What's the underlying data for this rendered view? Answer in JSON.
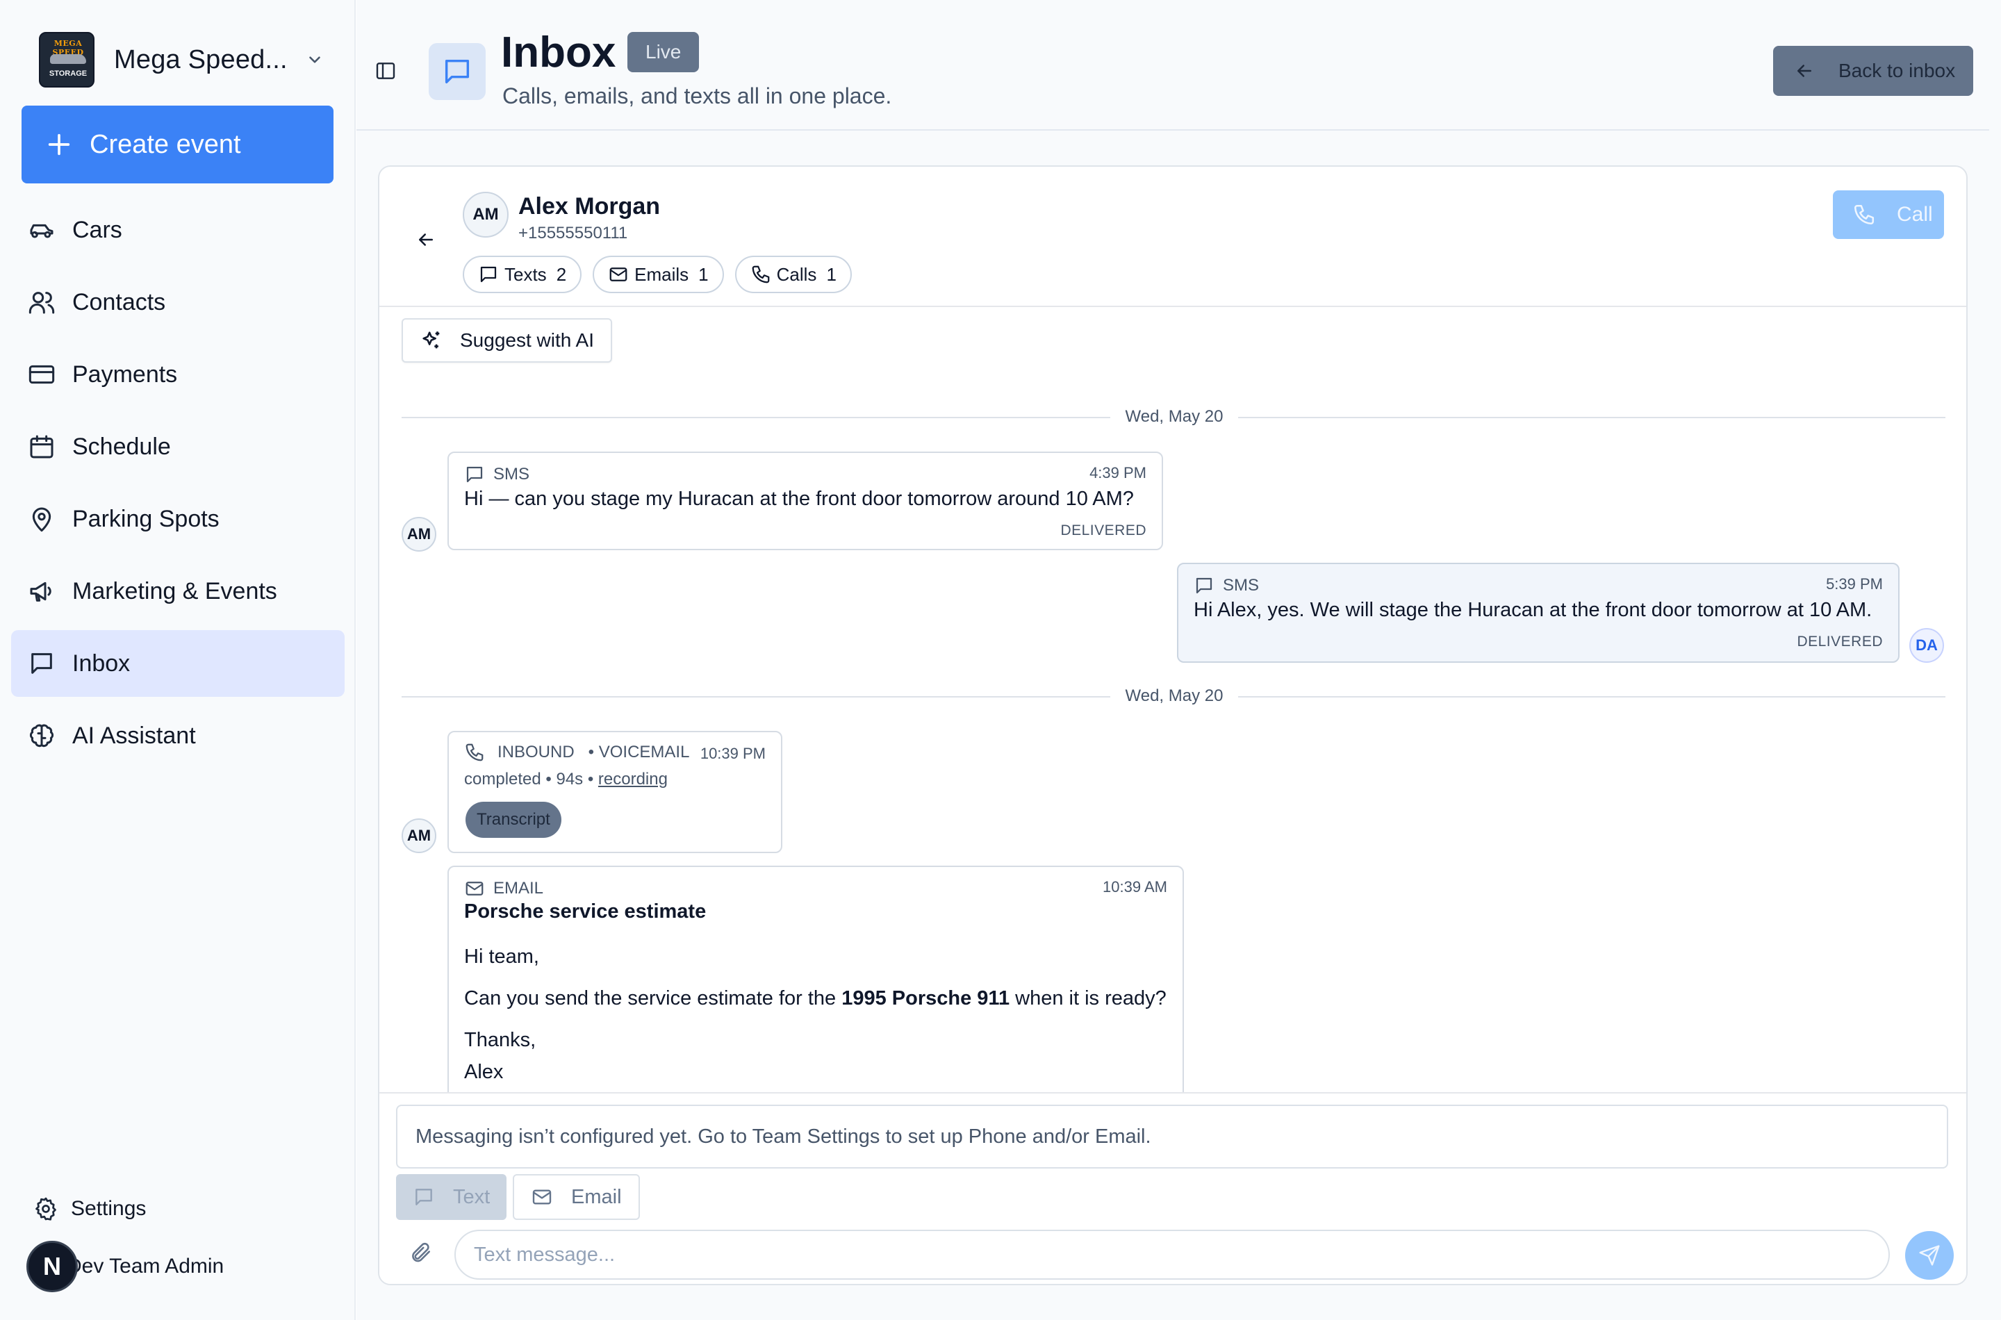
{
  "sidebar": {
    "brand": {
      "name": "Mega Speed...",
      "logo_line1": "MEGA SPEED",
      "logo_line2": "STORAGE"
    },
    "create_button": "Create event",
    "items": [
      {
        "label": "Cars",
        "icon": "car-icon"
      },
      {
        "label": "Contacts",
        "icon": "users-icon"
      },
      {
        "label": "Payments",
        "icon": "credit-card-icon"
      },
      {
        "label": "Schedule",
        "icon": "calendar-icon"
      },
      {
        "label": "Parking Spots",
        "icon": "map-pin-icon"
      },
      {
        "label": "Marketing & Events",
        "icon": "megaphone-icon"
      },
      {
        "label": "Inbox",
        "icon": "message-square-icon",
        "active": true
      },
      {
        "label": "AI Assistant",
        "icon": "brain-icon"
      }
    ],
    "settings_label": "Settings",
    "user": {
      "initial": "N",
      "name": "Dev Team Admin"
    }
  },
  "header": {
    "title": "Inbox",
    "badge": "Live",
    "subtitle": "Calls, emails, and texts all in one place.",
    "back_button": "Back to inbox"
  },
  "conversation": {
    "contact": {
      "initials": "AM",
      "name": "Alex Morgan",
      "phone": "+15555550111"
    },
    "pills": [
      {
        "label": "Texts",
        "count": "2"
      },
      {
        "label": "Emails",
        "count": "1"
      },
      {
        "label": "Calls",
        "count": "1"
      }
    ],
    "call_button": "Call",
    "suggest_button": "Suggest with AI",
    "date_dividers": [
      "Wed, May 20",
      "Wed, May 20"
    ],
    "messages": [
      {
        "type": "SMS",
        "time": "4:39 PM",
        "text": "Hi — can you stage my Huracan at the front door tomorrow around 10 AM?",
        "status": "DELIVERED",
        "avatar": "AM"
      },
      {
        "type": "SMS",
        "time": "5:39 PM",
        "text": "Hi Alex, yes. We will stage the Huracan at the front door tomorrow at 10 AM.",
        "status": "DELIVERED",
        "avatar": "DA"
      }
    ],
    "voicemail": {
      "direction": "INBOUND",
      "kind": "• VOICEMAIL",
      "time": "10:39 PM",
      "meta": "completed • 94s •",
      "recording_link": "recording",
      "transcript_button": "Transcript",
      "avatar": "AM"
    },
    "email": {
      "type": "EMAIL",
      "time": "10:39 AM",
      "subject": "Porsche service estimate",
      "greeting": "Hi team,",
      "body_before": "Can you send the service estimate for the ",
      "body_bold": "1995 Porsche 911",
      "body_after": " when it is ready?",
      "signoff": "Thanks,",
      "signature": "Alex"
    }
  },
  "composer": {
    "notice": "Messaging isn’t configured yet. Go to Team Settings to set up Phone and/or Email.",
    "tabs": [
      "Text",
      "Email"
    ],
    "placeholder": "Text message..."
  },
  "colors": {
    "accent": "#3b82f6",
    "active_nav": "#e0e7ff",
    "badge": "#64748b"
  }
}
